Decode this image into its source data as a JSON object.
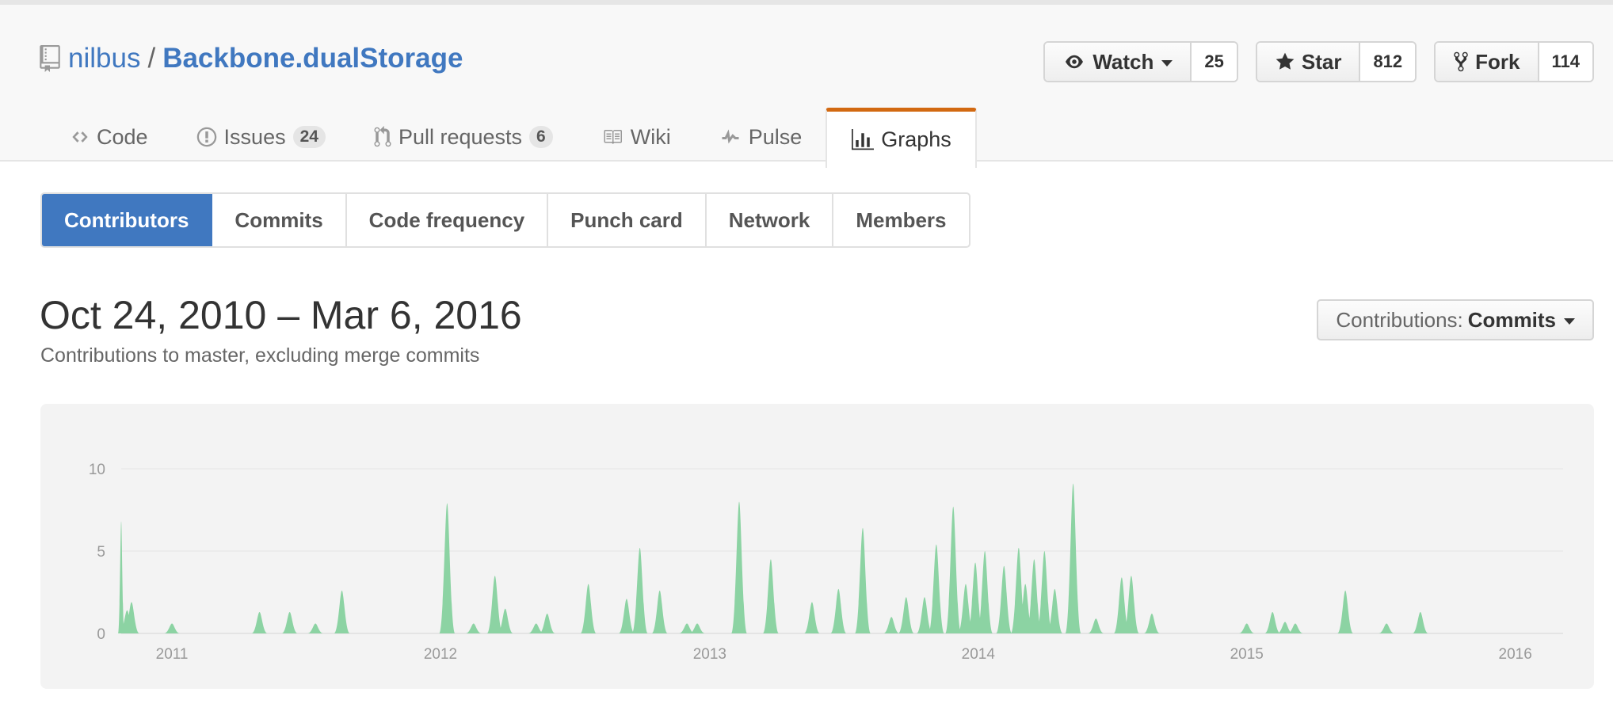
{
  "repo": {
    "owner": "nilbus",
    "separator": "/",
    "name": "Backbone.dualStorage"
  },
  "actions": {
    "watch": {
      "label": "Watch",
      "count": "25"
    },
    "star": {
      "label": "Star",
      "count": "812"
    },
    "fork": {
      "label": "Fork",
      "count": "114"
    }
  },
  "reponav": [
    {
      "label": "Code",
      "icon": "code-icon"
    },
    {
      "label": "Issues",
      "icon": "issue-icon",
      "counter": "24"
    },
    {
      "label": "Pull requests",
      "icon": "pull-request-icon",
      "counter": "6"
    },
    {
      "label": "Wiki",
      "icon": "book-icon"
    },
    {
      "label": "Pulse",
      "icon": "pulse-icon"
    },
    {
      "label": "Graphs",
      "icon": "graph-icon",
      "selected": true
    }
  ],
  "subnav": [
    "Contributors",
    "Commits",
    "Code frequency",
    "Punch card",
    "Network",
    "Members"
  ],
  "heading": {
    "title": "Oct 24, 2010 – Mar 6, 2016",
    "subtitle": "Contributions to master, excluding merge commits"
  },
  "contrib_select": {
    "prefix": "Contributions:",
    "value": "Commits"
  },
  "colors": {
    "accent": "#4078c0",
    "nav_selected": "#d26911",
    "area": "#8cd3a3"
  },
  "chart_data": {
    "type": "area",
    "title": "",
    "xlabel": "",
    "ylabel": "",
    "ylim": [
      0,
      10
    ],
    "yticks": [
      "0",
      "5",
      "10"
    ],
    "xticks": [
      {
        "label": "2011",
        "x": "2011-01-01"
      },
      {
        "label": "2012",
        "x": "2012-01-01"
      },
      {
        "label": "2013",
        "x": "2013-01-01"
      },
      {
        "label": "2014",
        "x": "2014-01-01"
      },
      {
        "label": "2015",
        "x": "2015-01-01"
      },
      {
        "label": "2016",
        "x": "2016-01-01"
      }
    ],
    "grid": true,
    "series": [
      {
        "points": [
          [
            "2010-10-24",
            6.8
          ],
          [
            "2010-11-01",
            1.4
          ],
          [
            "2010-11-07",
            1.9
          ],
          [
            "2011-01-01",
            0.6
          ],
          [
            "2011-04-30",
            1.3
          ],
          [
            "2011-06-10",
            1.3
          ],
          [
            "2011-07-15",
            0.6
          ],
          [
            "2011-08-20",
            2.6
          ],
          [
            "2012-01-10",
            7.9
          ],
          [
            "2012-02-15",
            0.6
          ],
          [
            "2012-03-15",
            3.5
          ],
          [
            "2012-03-29",
            1.5
          ],
          [
            "2012-05-10",
            0.6
          ],
          [
            "2012-05-25",
            1.2
          ],
          [
            "2012-07-20",
            3.0
          ],
          [
            "2012-09-10",
            2.1
          ],
          [
            "2012-09-28",
            5.2
          ],
          [
            "2012-10-25",
            2.6
          ],
          [
            "2012-12-01",
            0.6
          ],
          [
            "2012-12-15",
            0.6
          ],
          [
            "2013-02-10",
            8.0
          ],
          [
            "2013-03-25",
            4.5
          ],
          [
            "2013-05-20",
            1.9
          ],
          [
            "2013-06-25",
            2.7
          ],
          [
            "2013-07-28",
            6.4
          ],
          [
            "2013-09-05",
            1.0
          ],
          [
            "2013-09-25",
            2.2
          ],
          [
            "2013-10-20",
            2.2
          ],
          [
            "2013-11-05",
            5.4
          ],
          [
            "2013-11-28",
            7.7
          ],
          [
            "2013-12-15",
            3.0
          ],
          [
            "2013-12-28",
            4.3
          ],
          [
            "2014-01-10",
            5.0
          ],
          [
            "2014-02-05",
            4.1
          ],
          [
            "2014-02-25",
            5.2
          ],
          [
            "2014-03-06",
            3.0
          ],
          [
            "2014-03-18",
            4.5
          ],
          [
            "2014-04-01",
            5.0
          ],
          [
            "2014-04-15",
            2.7
          ],
          [
            "2014-05-10",
            9.1
          ],
          [
            "2014-06-10",
            0.9
          ],
          [
            "2014-07-15",
            3.4
          ],
          [
            "2014-07-28",
            3.5
          ],
          [
            "2014-08-25",
            1.2
          ],
          [
            "2015-01-01",
            0.6
          ],
          [
            "2015-02-05",
            1.3
          ],
          [
            "2015-02-22",
            0.7
          ],
          [
            "2015-03-08",
            0.6
          ],
          [
            "2015-05-15",
            2.6
          ],
          [
            "2015-07-10",
            0.6
          ],
          [
            "2015-08-25",
            1.3
          ]
        ]
      }
    ]
  }
}
